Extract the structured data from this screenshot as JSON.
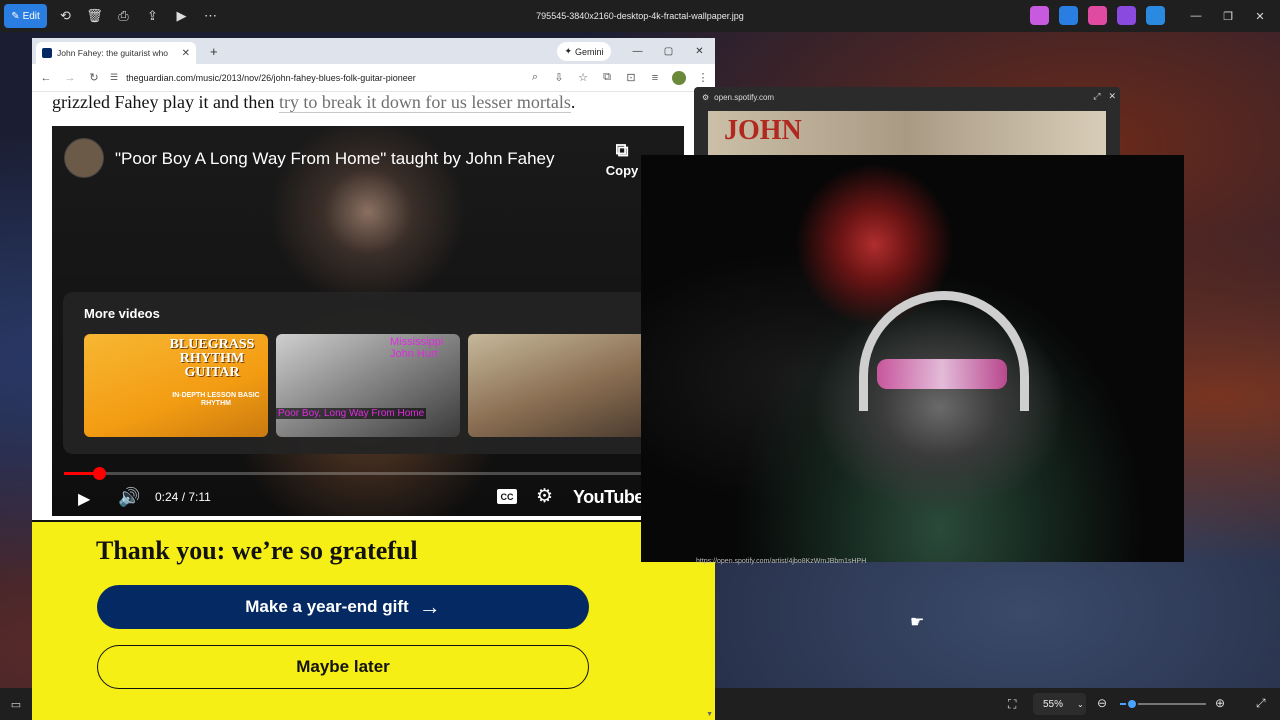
{
  "viewer": {
    "edit_label": "Edit",
    "file_title": "795545-3840x2160-desktop-4k-fractal-wallpaper.jpg",
    "zoom_level": "55%",
    "zoom_fraction": 0.14,
    "icons": [
      "rotate-icon",
      "delete-icon",
      "print-icon",
      "share-icon",
      "slideshow-icon",
      "more-icon"
    ],
    "app_icons": [
      {
        "name": "copilot-icon",
        "color": "#c85ae0"
      },
      {
        "name": "photos-edit-icon",
        "color": "#2a7de1"
      },
      {
        "name": "paint-icon",
        "color": "#e04aa0"
      },
      {
        "name": "clipchamp-icon",
        "color": "#8a4ae0"
      },
      {
        "name": "onedrive-icon",
        "color": "#2a8ae0"
      }
    ]
  },
  "browser": {
    "tab_title": "John Fahey: the guitarist who",
    "gemini_label": "Gemini",
    "url": "theguardian.com/music/2013/nov/26/john-fahey-blues-folk-guitar-pioneer",
    "article_text_before": "grizzled Fahey play it and then ",
    "article_link": "try to break it down for us lesser mortals",
    "article_text_after": "."
  },
  "youtube": {
    "video_title": "\"Poor Boy A Long Way From Home\" taught by John Fahey",
    "copy_label": "Copy",
    "more_videos_label": "More videos",
    "thumb1_title": "BLUEGRASS RHYTHM GUITAR",
    "thumb1_sub": "IN-DEPTH LESSON BASIC RHYTHM",
    "thumb2_top": "Mississippi John Hurt",
    "thumb2_bottom": "Poor Boy, Long Way From Home",
    "time": "0:24 / 7:11",
    "progress_fraction": 0.056,
    "cc_label": "CC",
    "brand": "YouTube",
    "accent_color": "#ff0000"
  },
  "banner": {
    "title": "Thank you: we’re so grateful",
    "gift_button": "Make a year-end gift",
    "later_button": "Maybe later",
    "banner_color": "#f6ef15",
    "button_color": "#052962"
  },
  "spotify": {
    "host": "open.spotify.com",
    "art_text": "JOHN",
    "status_url": "https://open.spotify.com/artist/4jbo8KzWmJBbm1sHPH"
  }
}
